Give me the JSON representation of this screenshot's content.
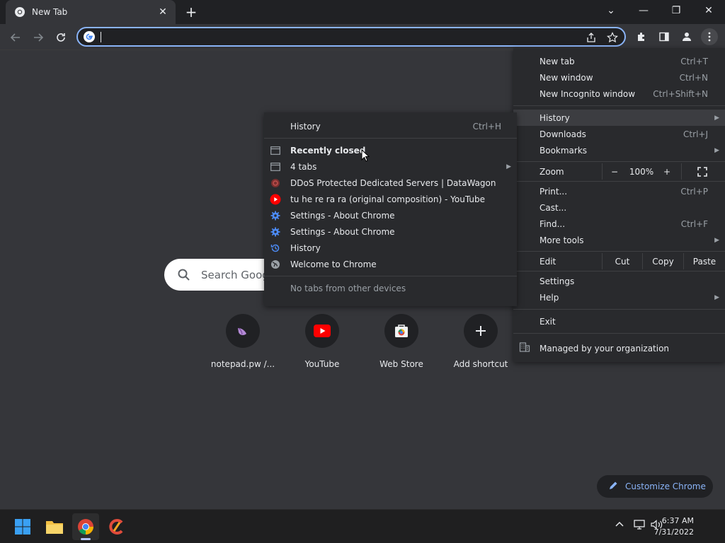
{
  "tab": {
    "title": "New Tab",
    "close": "✕"
  },
  "window": {
    "new_tab": "+",
    "dropdown": "⌄",
    "minimize": "—",
    "restore": "❐",
    "close": "✕"
  },
  "omnibox": {
    "value": ""
  },
  "ntp": {
    "search_placeholder": "Search Google or type a URL",
    "shortcuts": [
      {
        "label": "notepad.pw /...",
        "icon": "notepad-icon"
      },
      {
        "label": "YouTube",
        "icon": "youtube-icon"
      },
      {
        "label": "Web Store",
        "icon": "webstore-icon"
      },
      {
        "label": "Add shortcut",
        "icon": "plus-icon"
      }
    ],
    "customize": "Customize Chrome"
  },
  "menu": {
    "new_tab": {
      "label": "New tab",
      "shortcut": "Ctrl+T"
    },
    "new_window": {
      "label": "New window",
      "shortcut": "Ctrl+N"
    },
    "incognito": {
      "label": "New Incognito window",
      "shortcut": "Ctrl+Shift+N"
    },
    "history": {
      "label": "History"
    },
    "downloads": {
      "label": "Downloads",
      "shortcut": "Ctrl+J"
    },
    "bookmarks": {
      "label": "Bookmarks"
    },
    "zoom": {
      "label": "Zoom",
      "minus": "−",
      "value": "100%",
      "plus": "+"
    },
    "print": {
      "label": "Print...",
      "shortcut": "Ctrl+P"
    },
    "cast": {
      "label": "Cast..."
    },
    "find": {
      "label": "Find...",
      "shortcut": "Ctrl+F"
    },
    "more_tools": {
      "label": "More tools"
    },
    "edit": {
      "label": "Edit",
      "cut": "Cut",
      "copy": "Copy",
      "paste": "Paste"
    },
    "settings": {
      "label": "Settings"
    },
    "help": {
      "label": "Help"
    },
    "exit": {
      "label": "Exit"
    },
    "managed": {
      "label": "Managed by your organization"
    }
  },
  "history_submenu": {
    "history": {
      "label": "History",
      "shortcut": "Ctrl+H"
    },
    "recently_closed": "Recently closed",
    "items": [
      {
        "label": "4 tabs",
        "icon": "tabs-icon",
        "has_arrow": true
      },
      {
        "label": "DDoS Protected Dedicated Servers | DataWagon",
        "icon": "datawagon-icon"
      },
      {
        "label": "tu he re ra ra (original composition) - YouTube",
        "icon": "youtube-icon"
      },
      {
        "label": "Settings - About Chrome",
        "icon": "gear-icon"
      },
      {
        "label": "Settings - About Chrome",
        "icon": "gear-icon"
      },
      {
        "label": "History",
        "icon": "history-icon"
      },
      {
        "label": "Welcome to Chrome",
        "icon": "globe-icon"
      }
    ],
    "no_tabs": "No tabs from other devices"
  },
  "taskbar": {
    "time": "6:37 AM",
    "date": "7/31/2022"
  },
  "colors": {
    "accent": "#8ab4f8",
    "menu_bg": "#292a2d",
    "page_bg": "#35363a"
  }
}
